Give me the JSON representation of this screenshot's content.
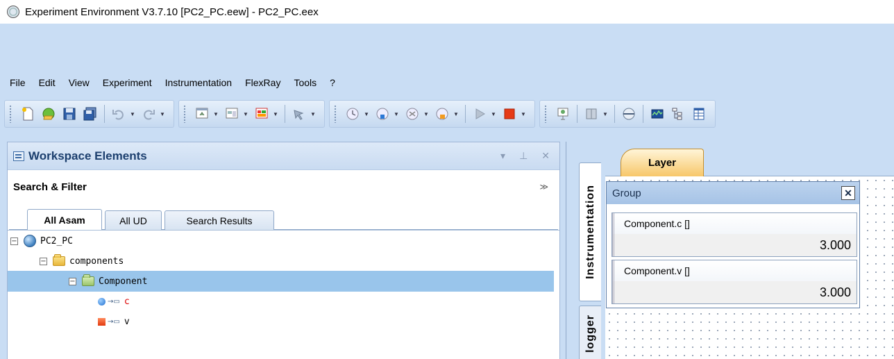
{
  "window": {
    "title": "Experiment Environment V3.7.10  [PC2_PC.eew] - PC2_PC.eex"
  },
  "menu": [
    "File",
    "Edit",
    "View",
    "Experiment",
    "Instrumentation",
    "FlexRay",
    "Tools",
    "?"
  ],
  "workspace": {
    "title": "Workspace Elements",
    "ctrls": {
      "dropdown": "▾",
      "pin": "⊥",
      "close": "✕"
    },
    "search_filter": "Search & Filter",
    "collapse": "≫",
    "tabs": [
      "All Asam",
      "All UD",
      "Search Results"
    ],
    "tree": {
      "root": "PC2_PC",
      "folder": "components",
      "component": "Component",
      "signals": [
        {
          "name": "c",
          "color": "#d00000"
        },
        {
          "name": "v",
          "color": "#000000"
        }
      ],
      "expand_glyph": "−",
      "arrow_glyph": "→▭"
    }
  },
  "instrumentation": {
    "vtabs": [
      "Instrumentation",
      "logger"
    ],
    "layer_tab": "Layer",
    "group": {
      "title": "Group",
      "close_glyph": "✕",
      "components": [
        {
          "name": "Component.c []",
          "value": "3.000"
        },
        {
          "name": "Component.v []",
          "value": "3.000"
        }
      ]
    }
  },
  "colors": {
    "chrome": "#c9ddf4",
    "selected_row": "#99c5eb",
    "layer_tab": "#f7c76a"
  }
}
